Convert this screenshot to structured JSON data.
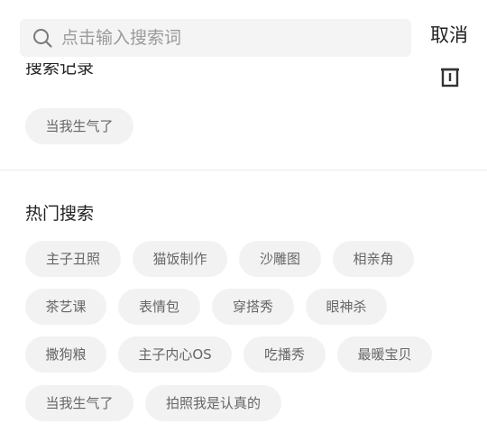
{
  "search": {
    "placeholder": "点击输入搜索词",
    "value": "",
    "cancel_label": "取消"
  },
  "history": {
    "title": "搜索记录",
    "items": [
      {
        "label": "当我生气了"
      }
    ]
  },
  "hot": {
    "title": "热门搜索",
    "items": [
      {
        "label": "主子丑照"
      },
      {
        "label": "猫饭制作"
      },
      {
        "label": "沙雕图"
      },
      {
        "label": "相亲角"
      },
      {
        "label": "茶艺课"
      },
      {
        "label": "表情包"
      },
      {
        "label": "穿搭秀"
      },
      {
        "label": "眼神杀"
      },
      {
        "label": "撒狗粮"
      },
      {
        "label": "主子内心OS"
      },
      {
        "label": "吃播秀"
      },
      {
        "label": "最暖宝贝"
      },
      {
        "label": "当我生气了"
      },
      {
        "label": "拍照我是认真的"
      }
    ]
  },
  "colors": {
    "tag_background": "#f2f2f2",
    "tag_text": "#666666",
    "search_background": "#f4f4f4",
    "title_text": "#222222"
  },
  "icons": {
    "search": "search-icon",
    "trash": "trash-icon"
  }
}
